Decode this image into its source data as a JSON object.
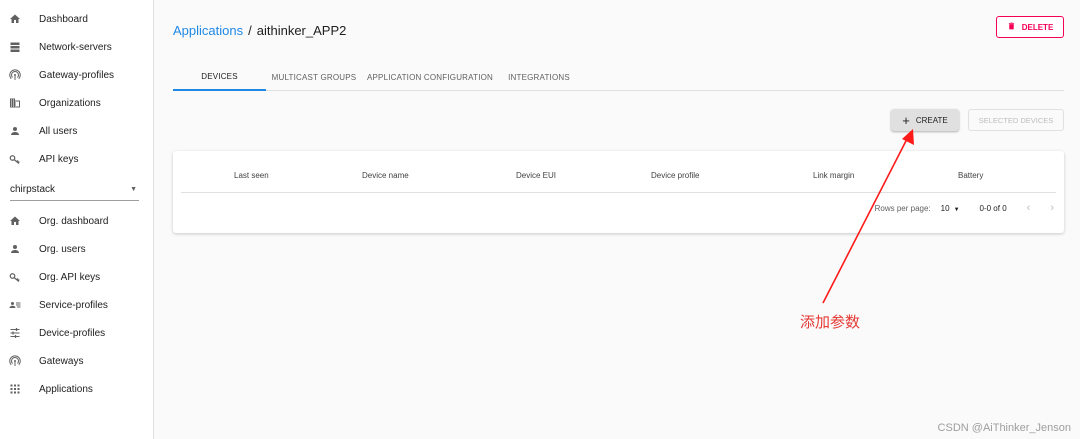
{
  "sidebar": {
    "items": [
      {
        "label": "Dashboard",
        "icon": "home-icon"
      },
      {
        "label": "Network-servers",
        "icon": "servers-icon"
      },
      {
        "label": "Gateway-profiles",
        "icon": "radio-tower-icon"
      },
      {
        "label": "Organizations",
        "icon": "domain-icon"
      },
      {
        "label": "All users",
        "icon": "account-icon"
      },
      {
        "label": "API keys",
        "icon": "key-icon"
      }
    ],
    "org_select": {
      "value": "chirpstack"
    },
    "org_items": [
      {
        "label": "Org. dashboard",
        "icon": "home-icon"
      },
      {
        "label": "Org. users",
        "icon": "account-icon"
      },
      {
        "label": "Org. API keys",
        "icon": "key-icon"
      },
      {
        "label": "Service-profiles",
        "icon": "account-details-icon"
      },
      {
        "label": "Device-profiles",
        "icon": "tune-icon"
      },
      {
        "label": "Gateways",
        "icon": "radio-tower-icon"
      },
      {
        "label": "Applications",
        "icon": "apps-grid-icon"
      }
    ]
  },
  "breadcrumb": {
    "parent": "Applications",
    "separator": "/",
    "current": "aithinker_APP2"
  },
  "delete_label": "DELETE",
  "tabs": [
    "DEVICES",
    "MULTICAST GROUPS",
    "APPLICATION CONFIGURATION",
    "INTEGRATIONS"
  ],
  "create_label": "CREATE",
  "selected_devices_label": "SELECTED DEVICES",
  "table": {
    "headers": [
      "Last seen",
      "Device name",
      "Device EUI",
      "Device profile",
      "Link margin",
      "Battery"
    ]
  },
  "pager": {
    "rows_label": "Rows per page:",
    "rows_value": "10",
    "range": "0-0 of 0",
    "prev": "‹",
    "next": "›"
  },
  "annotation": "添加参数",
  "watermark": "CSDN @AiThinker_Jenson",
  "colors": {
    "accent": "#1e88e5",
    "danger": "#f50057",
    "annotation": "#e53935"
  }
}
